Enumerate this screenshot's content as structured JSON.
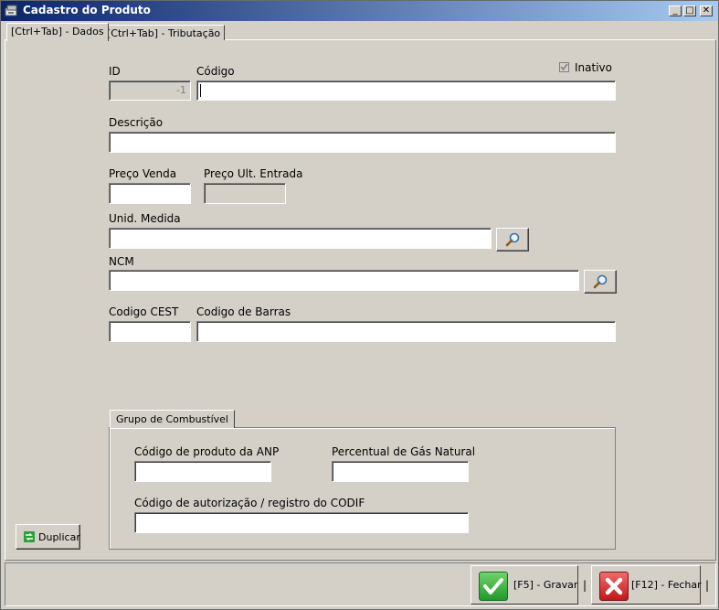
{
  "window": {
    "title": "Cadastro do Produto",
    "minimize_glyph": "_",
    "maximize_glyph": "□",
    "close_glyph": "✕"
  },
  "tabs": [
    {
      "label": "[Ctrl+Tab] - Dados",
      "active": true
    },
    {
      "label": "[Ctrl+Tab] - Tributação",
      "active": false
    }
  ],
  "form": {
    "id_label": "ID",
    "id_value": "-1",
    "codigo_label": "Código",
    "codigo_value": "",
    "inativo_label": "Inativo",
    "inativo_checked": true,
    "descricao_label": "Descrição",
    "preco_venda_label": "Preço Venda",
    "preco_ult_entrada_label": "Preço Ult. Entrada",
    "unid_medida_label": "Unid. Medida",
    "ncm_label": "NCM",
    "codigo_cest_label": "Codigo CEST",
    "codigo_barras_label": "Codigo de Barras"
  },
  "combustivel": {
    "group_label": "Grupo de Combustível",
    "anp_label": "Código de produto da ANP",
    "gas_natural_label": "Percentual de Gás Natural",
    "codif_label": "Código de autorização / registro do CODIF"
  },
  "buttons": {
    "duplicar_label": "Duplicar",
    "gravar_label": "[F5] - Gravar",
    "fechar_label": "[F12] - Fechar",
    "separator": "|"
  },
  "icons": {
    "search": "magnifier-icon",
    "gravar": "checkmark-icon",
    "fechar": "x-mark-icon",
    "duplicar": "duplicate-icon"
  },
  "colors": {
    "title_start": "#0a246a",
    "title_end": "#a6caf0",
    "surface": "#d4d0c8",
    "gravar_green": "#2fb12f",
    "fechar_red": "#d42a2a"
  }
}
